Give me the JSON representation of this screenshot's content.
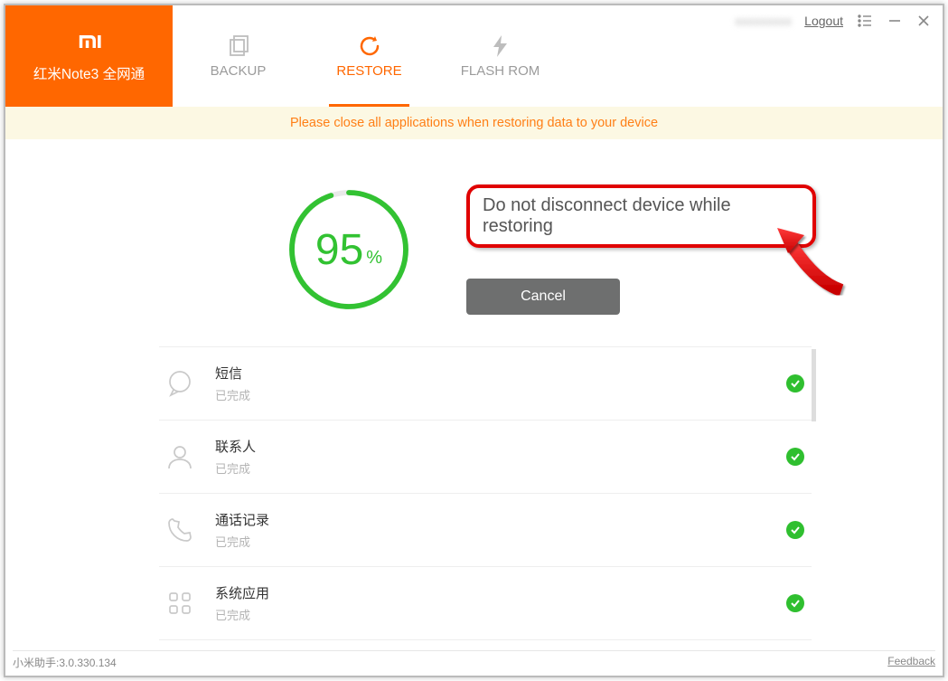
{
  "colors": {
    "accent": "#ff6700",
    "success": "#2fbf2f",
    "danger": "#e00000"
  },
  "logo": {
    "device": "红米Note3 全网通"
  },
  "tabs": {
    "backup": "BACKUP",
    "restore": "RESTORE",
    "flash": "FLASH ROM",
    "active": "restore"
  },
  "header_user": "xxxxxxxxx",
  "logout": "Logout",
  "banner": "Please close all applications when restoring data to your device",
  "progress": {
    "value": 95,
    "suffix": "%"
  },
  "warning": "Do not disconnect device while restoring",
  "cancel": "Cancel",
  "items": [
    {
      "icon": "chat",
      "name": "短信",
      "status": "已完成"
    },
    {
      "icon": "contact",
      "name": "联系人",
      "status": "已完成"
    },
    {
      "icon": "phone",
      "name": "通话记录",
      "status": "已完成"
    },
    {
      "icon": "apps",
      "name": "系统应用",
      "status": "已完成"
    }
  ],
  "footer": {
    "version": "小米助手:3.0.330.134",
    "feedback": "Feedback"
  }
}
